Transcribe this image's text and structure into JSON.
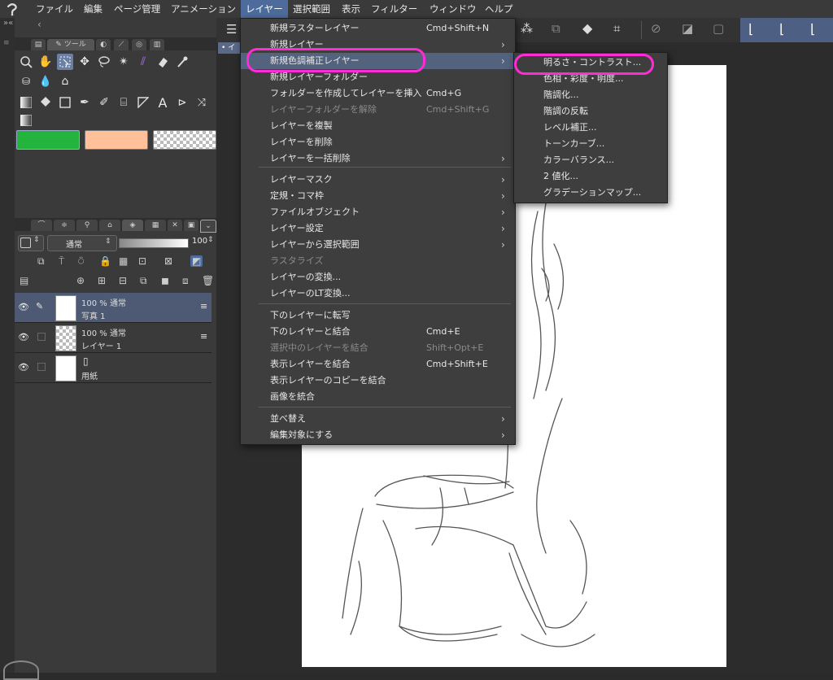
{
  "menubar": {
    "items": [
      "ファイル",
      "編集",
      "ページ管理",
      "アニメーション",
      "レイヤー",
      "選択範囲",
      "表示",
      "フィルター",
      "ウィンドウ",
      "ヘルプ"
    ],
    "active_index": 4
  },
  "left_panel": {
    "tool_tab_label": "ツール",
    "colors": {
      "main": "#22b43c",
      "sub": "#ffc09a"
    },
    "layer_blend_mode": "通常",
    "layer_opacity": "100",
    "layers": [
      {
        "opacity_mode": "100 % 通常",
        "name": "写真 1",
        "selected": true
      },
      {
        "opacity_mode": "100 % 通常",
        "name": "レイヤー 1",
        "selected": false
      },
      {
        "opacity_mode": "",
        "name": "用紙",
        "selected": false
      }
    ]
  },
  "layer_menu": {
    "items": [
      {
        "label": "新規ラスターレイヤー",
        "shortcut": "Cmd+Shift+N",
        "arrow": false,
        "disabled": false
      },
      {
        "label": "新規レイヤー",
        "shortcut": "",
        "arrow": true,
        "disabled": false
      },
      {
        "label": "新規色調補正レイヤー",
        "shortcut": "",
        "arrow": true,
        "disabled": false,
        "highlighted": true
      },
      {
        "label": "新規レイヤーフォルダー",
        "shortcut": "",
        "arrow": false,
        "disabled": false
      },
      {
        "label": "フォルダーを作成してレイヤーを挿入",
        "shortcut": "Cmd+G",
        "arrow": false,
        "disabled": false
      },
      {
        "label": "レイヤーフォルダーを解除",
        "shortcut": "Cmd+Shift+G",
        "arrow": false,
        "disabled": true
      },
      {
        "label": "レイヤーを複製",
        "shortcut": "",
        "arrow": false,
        "disabled": false
      },
      {
        "label": "レイヤーを削除",
        "shortcut": "",
        "arrow": false,
        "disabled": false
      },
      {
        "label": "レイヤーを一括削除",
        "shortcut": "",
        "arrow": true,
        "disabled": false
      },
      {
        "label": "レイヤーマスク",
        "shortcut": "",
        "arrow": true,
        "disabled": false
      },
      {
        "label": "定規・コマ枠",
        "shortcut": "",
        "arrow": true,
        "disabled": false
      },
      {
        "label": "ファイルオブジェクト",
        "shortcut": "",
        "arrow": true,
        "disabled": false
      },
      {
        "label": "レイヤー設定",
        "shortcut": "",
        "arrow": true,
        "disabled": false
      },
      {
        "label": "レイヤーから選択範囲",
        "shortcut": "",
        "arrow": true,
        "disabled": false
      },
      {
        "label": "ラスタライズ",
        "shortcut": "",
        "arrow": false,
        "disabled": true
      },
      {
        "label": "レイヤーの変換...",
        "shortcut": "",
        "arrow": false,
        "disabled": false
      },
      {
        "label": "レイヤーのLT変換...",
        "shortcut": "",
        "arrow": false,
        "disabled": false
      },
      {
        "label": "下のレイヤーに転写",
        "shortcut": "",
        "arrow": false,
        "disabled": false
      },
      {
        "label": "下のレイヤーと結合",
        "shortcut": "Cmd+E",
        "arrow": false,
        "disabled": false
      },
      {
        "label": "選択中のレイヤーを結合",
        "shortcut": "Shift+Opt+E",
        "arrow": false,
        "disabled": true
      },
      {
        "label": "表示レイヤーを結合",
        "shortcut": "Cmd+Shift+E",
        "arrow": false,
        "disabled": false
      },
      {
        "label": "表示レイヤーのコピーを結合",
        "shortcut": "",
        "arrow": false,
        "disabled": false
      },
      {
        "label": "画像を統合",
        "shortcut": "",
        "arrow": false,
        "disabled": false
      },
      {
        "label": "並べ替え",
        "shortcut": "",
        "arrow": true,
        "disabled": false
      },
      {
        "label": "編集対象にする",
        "shortcut": "",
        "arrow": true,
        "disabled": false
      }
    ]
  },
  "submenu": {
    "items": [
      "明るさ・コントラスト...",
      "色相・彩度・明度...",
      "階調化...",
      "階調の反転",
      "レベル補正...",
      "トーンカーブ...",
      "カラーバランス...",
      "2 値化...",
      "グラデーションマップ..."
    ],
    "highlighted_index": 0
  },
  "annotation_color": "#ff2bd6"
}
